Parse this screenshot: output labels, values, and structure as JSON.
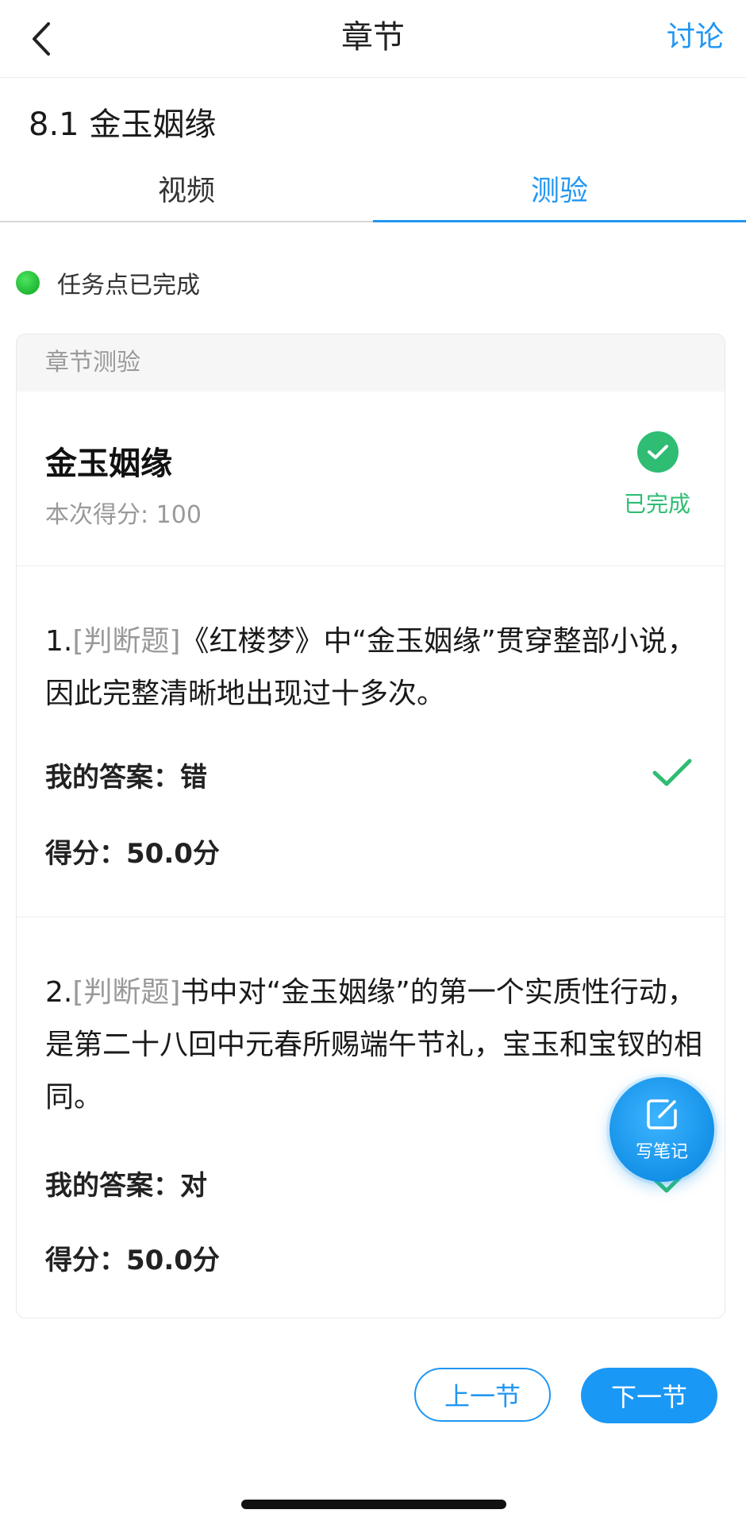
{
  "navbar": {
    "title": "章节",
    "action_label": "讨论",
    "back_icon": "chevron-left-icon"
  },
  "section_title": "8.1 金玉姻缘",
  "tabs": [
    {
      "label": "视频",
      "active": false
    },
    {
      "label": "测验",
      "active": true
    }
  ],
  "status": {
    "text": "任务点已完成",
    "color": "#22c03a"
  },
  "quiz": {
    "header": "章节测验",
    "name": "金玉姻缘",
    "score_text": "本次得分: 100",
    "done_label": "已完成",
    "done_color": "#2ebd73",
    "questions": [
      {
        "number": "1.",
        "type": "[判断题]",
        "text": "《红楼梦》中“金玉姻缘”贯穿整部小说，因此完整清晰地出现过十多次。",
        "answer": "我的答案：错",
        "points": "得分：50.0分",
        "correct": true
      },
      {
        "number": "2.",
        "type": "[判断题]",
        "text": "书中对“金玉姻缘”的第一个实质性行动，是第二十八回中元春所赐端午节礼，宝玉和宝钗的相同。",
        "answer": "我的答案：对",
        "points": "得分：50.0分",
        "correct": true
      }
    ]
  },
  "fab": {
    "label": "写笔记",
    "icon": "edit-note-icon"
  },
  "pager": {
    "prev_label": "上一节",
    "next_label": "下一节"
  },
  "colors": {
    "accent": "#2196f3",
    "success": "#2ebd73"
  }
}
